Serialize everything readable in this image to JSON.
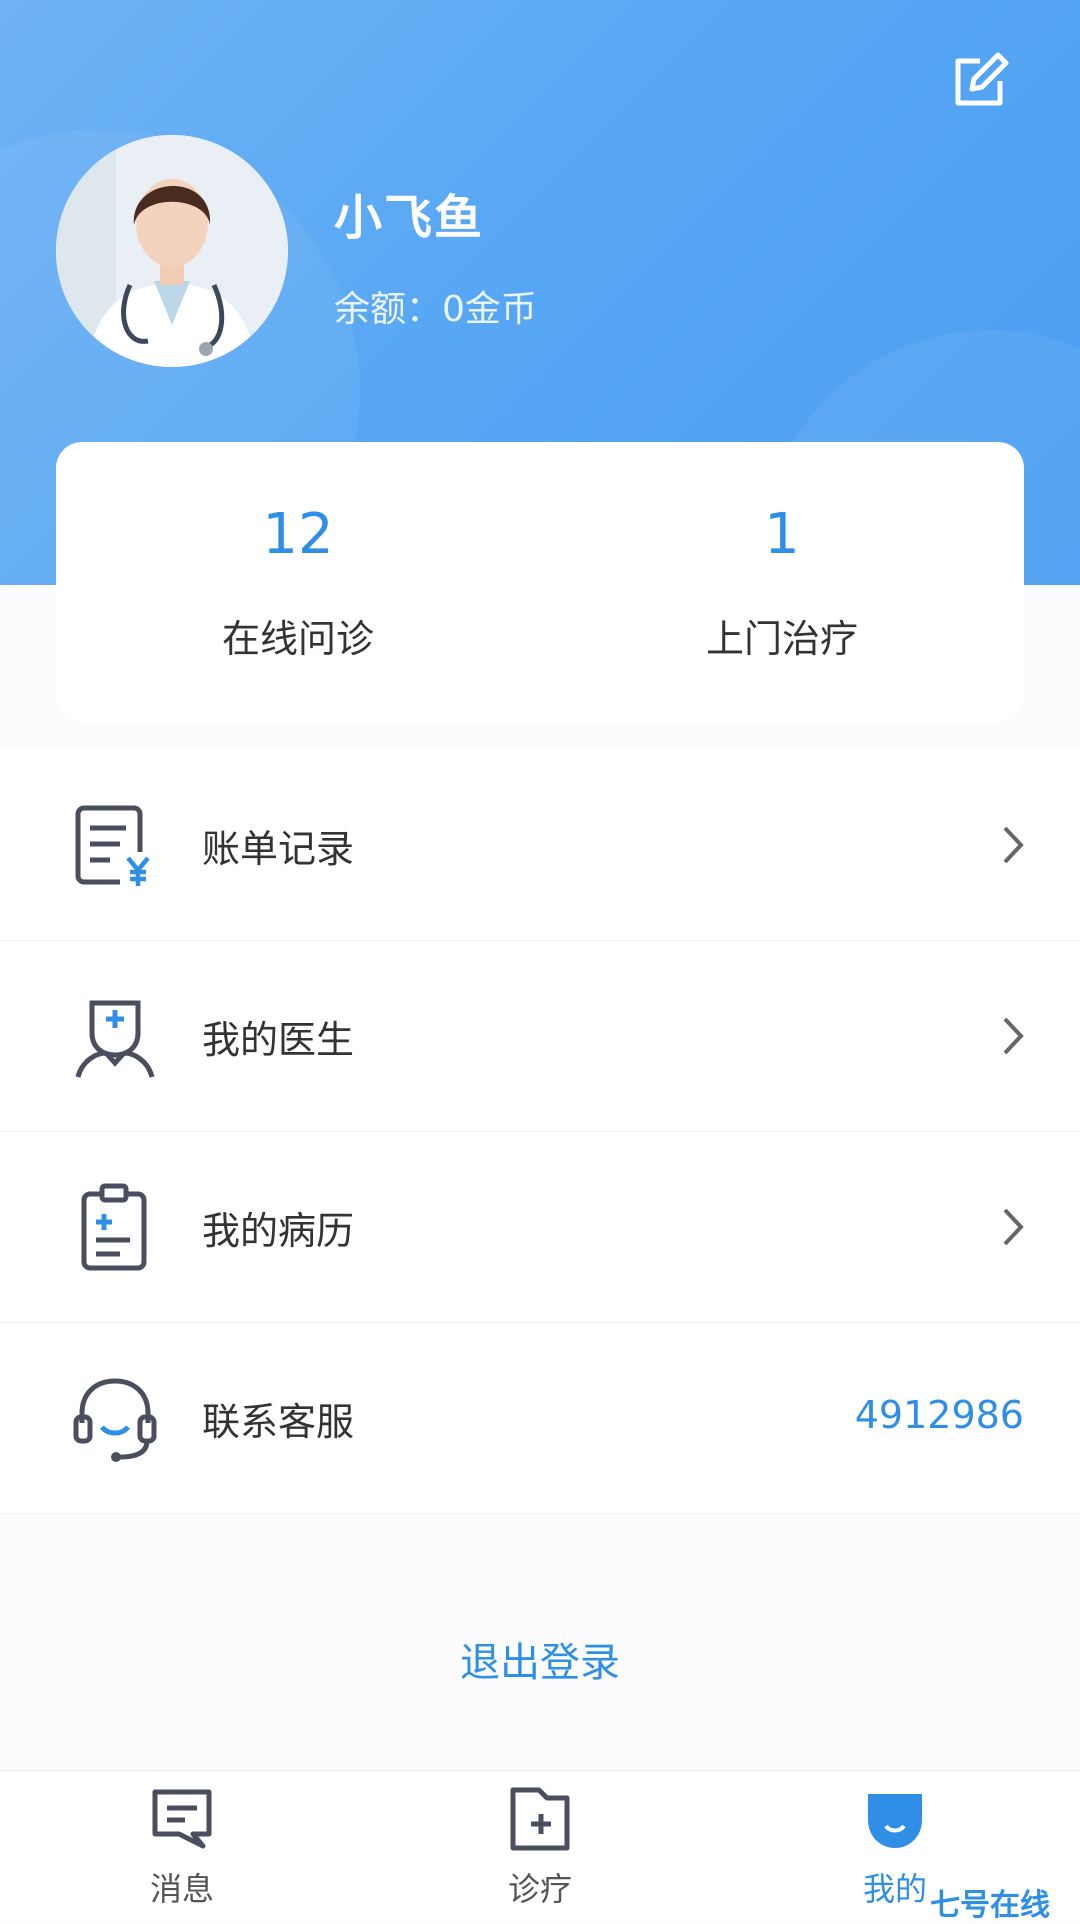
{
  "profile": {
    "name": "小飞鱼",
    "balance_text": "余额：0金币"
  },
  "stats": [
    {
      "value": "12",
      "label": "在线问诊"
    },
    {
      "value": "1",
      "label": "上门治疗"
    }
  ],
  "menu": {
    "bills": "账单记录",
    "doctor": "我的医生",
    "records": "我的病历",
    "service": "联系客服",
    "service_number": "4912986"
  },
  "logout_label": "退出登录",
  "tabs": [
    {
      "label": "消息",
      "icon": "message-icon"
    },
    {
      "label": "诊疗",
      "icon": "medical-folder-icon"
    },
    {
      "label": "我的",
      "icon": "profile-icon",
      "active": true
    }
  ],
  "watermark": "七号在线",
  "colors": {
    "accent": "#2f8fe6",
    "header": "#58a7f4"
  }
}
